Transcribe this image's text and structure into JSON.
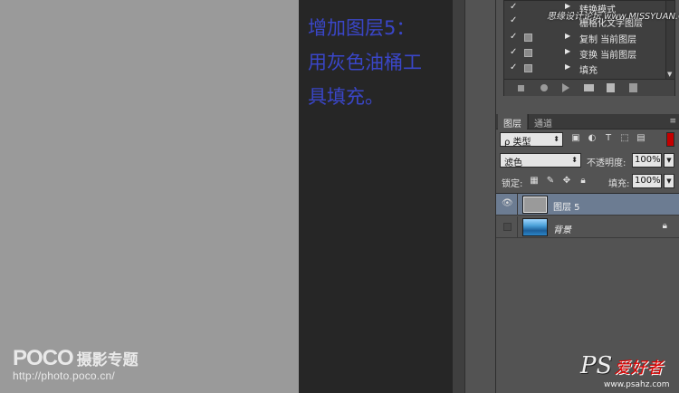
{
  "instruction_text": {
    "line1": "增加图层5：",
    "line2": "用灰色油桶工",
    "line3": "具填充。"
  },
  "watermarks": {
    "poco_brand": "POCO",
    "poco_cn": "摄影专题",
    "poco_url": "http://photo.poco.cn/",
    "site_overlay": "思缘设计论坛 www.MISSYUAN.COM",
    "ps_brand": "PS",
    "ps_cn": "爱好者",
    "ps_url": "www.psahz.com"
  },
  "actions_panel": {
    "items": [
      {
        "label": "转换模式",
        "checked": "✓"
      },
      {
        "label": "栅格化文字图层",
        "checked": "✓"
      },
      {
        "label": "复制 当前图层",
        "checked": "✓"
      },
      {
        "label": "变换 当前图层",
        "checked": "✓"
      },
      {
        "label": "填充",
        "checked": "✓"
      }
    ]
  },
  "layers_panel": {
    "tabs": [
      {
        "label": "图层",
        "active": true
      },
      {
        "label": "通道",
        "active": false
      }
    ],
    "filter_kind": "ρ 类型",
    "blend_mode": "滤色",
    "opacity_label": "不透明度:",
    "opacity_value": "100%",
    "lock_label": "锁定:",
    "fill_label": "填充:",
    "fill_value": "100%",
    "layers": [
      {
        "name": "图层 5",
        "visible": true,
        "selected": true,
        "thumb": "gray"
      },
      {
        "name": "背景",
        "visible": false,
        "selected": false,
        "thumb": "sea",
        "locked": true
      }
    ]
  },
  "colors": {
    "instruction_text": "#3a46c8",
    "selected_layer": "#6c7c92",
    "canvas_gray": "#9a9a9a",
    "panel_bg": "#535353"
  }
}
